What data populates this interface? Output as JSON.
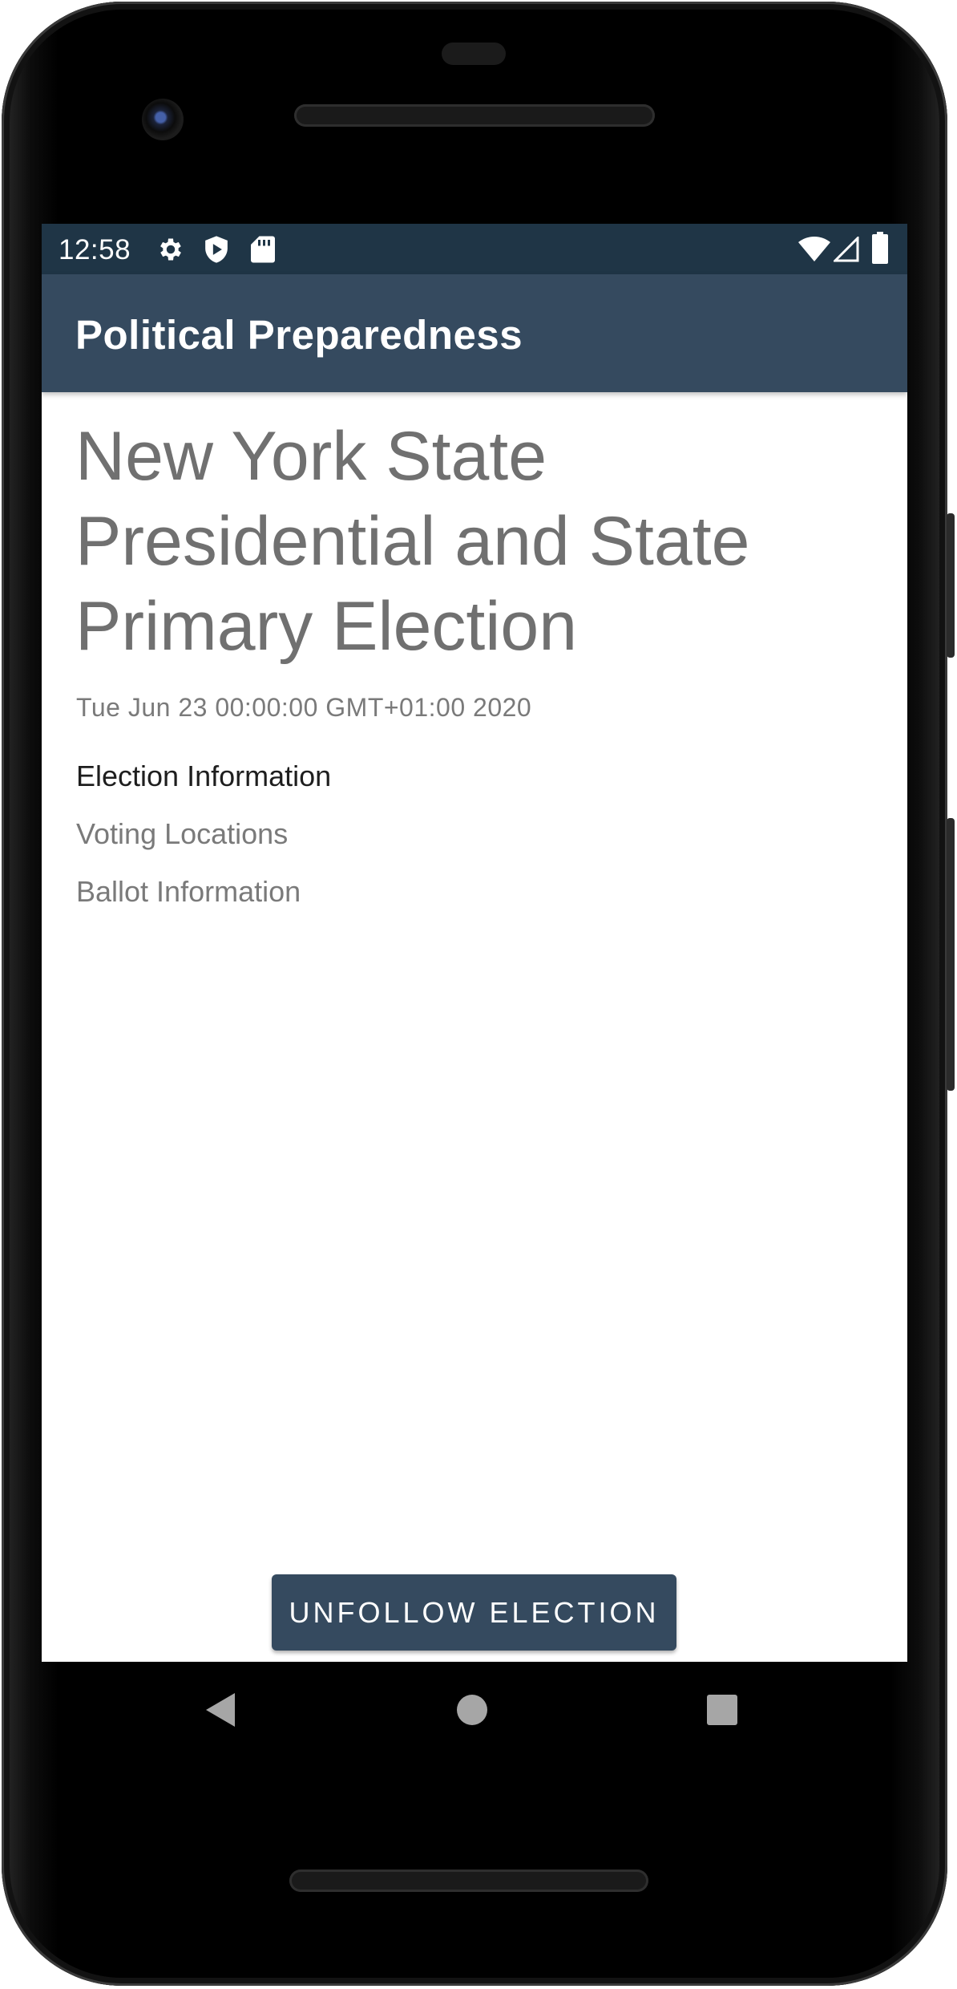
{
  "status_bar": {
    "time": "12:58",
    "left_icons": [
      "gear-icon",
      "shield-play-icon",
      "sd-card-icon"
    ],
    "right_icons": [
      "wifi-icon",
      "cell-signal-icon",
      "battery-icon"
    ]
  },
  "app_bar": {
    "title": "Political Preparedness"
  },
  "election": {
    "title": "New York State Presidential and State Primary Election",
    "date": "Tue Jun 23 00:00:00 GMT+01:00 2020",
    "info_header": "Election Information",
    "voting_locations": "Voting Locations",
    "ballot_information": "Ballot Information"
  },
  "actions": {
    "unfollow_label": "UNFOLLOW ELECTION"
  },
  "nav_bar": {
    "buttons": [
      "back-icon",
      "home-icon",
      "recents-icon"
    ]
  },
  "colors": {
    "status_bar": "#1f3546",
    "primary": "#354a5f",
    "title_text": "#707070",
    "secondary_text": "#7a7a7a"
  }
}
